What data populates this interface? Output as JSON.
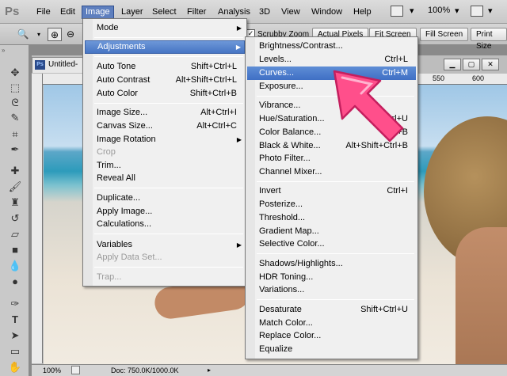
{
  "app": {
    "logo": "Ps"
  },
  "menubar": {
    "items": [
      {
        "label": "File"
      },
      {
        "label": "Edit"
      },
      {
        "label": "Image"
      },
      {
        "label": "Layer"
      },
      {
        "label": "Select"
      },
      {
        "label": "Filter"
      },
      {
        "label": "Analysis"
      },
      {
        "label": "3D"
      },
      {
        "label": "View"
      },
      {
        "label": "Window"
      },
      {
        "label": "Help"
      }
    ],
    "zoom": "100%"
  },
  "options": {
    "scrubby_zoom": "Scrubby Zoom",
    "actual_pixels": "Actual Pixels",
    "fit_screen": "Fit Screen",
    "fill_screen": "Fill Screen",
    "print_size": "Print Size"
  },
  "document": {
    "tab_title": "Untitled-",
    "ruler_mark": "550",
    "ruler_mark2": "600",
    "zoom": "100%",
    "doc_size": "Doc: 750.0K/1000.0K"
  },
  "image_menu": {
    "mode": "Mode",
    "adjustments": "Adjustments",
    "auto_tone": {
      "label": "Auto Tone",
      "shortcut": "Shift+Ctrl+L"
    },
    "auto_contrast": {
      "label": "Auto Contrast",
      "shortcut": "Alt+Shift+Ctrl+L"
    },
    "auto_color": {
      "label": "Auto Color",
      "shortcut": "Shift+Ctrl+B"
    },
    "image_size": {
      "label": "Image Size...",
      "shortcut": "Alt+Ctrl+I"
    },
    "canvas_size": {
      "label": "Canvas Size...",
      "shortcut": "Alt+Ctrl+C"
    },
    "image_rotation": "Image Rotation",
    "crop": "Crop",
    "trim": "Trim...",
    "reveal_all": "Reveal All",
    "duplicate": "Duplicate...",
    "apply_image": "Apply Image...",
    "calculations": "Calculations...",
    "variables": "Variables",
    "apply_data_set": "Apply Data Set...",
    "trap": "Trap..."
  },
  "adjustments_menu": {
    "brightness_contrast": {
      "label": "Brightness/Contrast...",
      "shortcut": ""
    },
    "levels": {
      "label": "Levels...",
      "shortcut": "Ctrl+L"
    },
    "curves": {
      "label": "Curves...",
      "shortcut": "Ctrl+M"
    },
    "exposure": {
      "label": "Exposure...",
      "shortcut": ""
    },
    "vibrance": {
      "label": "Vibrance...",
      "shortcut": ""
    },
    "hue_saturation": {
      "label": "Hue/Saturation...",
      "shortcut": "Ctrl+U"
    },
    "color_balance": {
      "label": "Color Balance...",
      "shortcut": "Ctrl+B"
    },
    "black_white": {
      "label": "Black & White...",
      "shortcut": "Alt+Shift+Ctrl+B"
    },
    "photo_filter": {
      "label": "Photo Filter...",
      "shortcut": ""
    },
    "channel_mixer": {
      "label": "Channel Mixer...",
      "shortcut": ""
    },
    "invert": {
      "label": "Invert",
      "shortcut": "Ctrl+I"
    },
    "posterize": {
      "label": "Posterize...",
      "shortcut": ""
    },
    "threshold": {
      "label": "Threshold...",
      "shortcut": ""
    },
    "gradient_map": {
      "label": "Gradient Map...",
      "shortcut": ""
    },
    "selective_color": {
      "label": "Selective Color...",
      "shortcut": ""
    },
    "shadows_highlights": {
      "label": "Shadows/Highlights...",
      "shortcut": ""
    },
    "hdr_toning": {
      "label": "HDR Toning...",
      "shortcut": ""
    },
    "variations": {
      "label": "Variations...",
      "shortcut": ""
    },
    "desaturate": {
      "label": "Desaturate",
      "shortcut": "Shift+Ctrl+U"
    },
    "match_color": {
      "label": "Match Color...",
      "shortcut": ""
    },
    "replace_color": {
      "label": "Replace Color...",
      "shortcut": ""
    },
    "equalize": {
      "label": "Equalize",
      "shortcut": ""
    }
  },
  "colors": {
    "menu_highlight": "#4675c4",
    "pointer_arrow": "#ff4f8b"
  }
}
